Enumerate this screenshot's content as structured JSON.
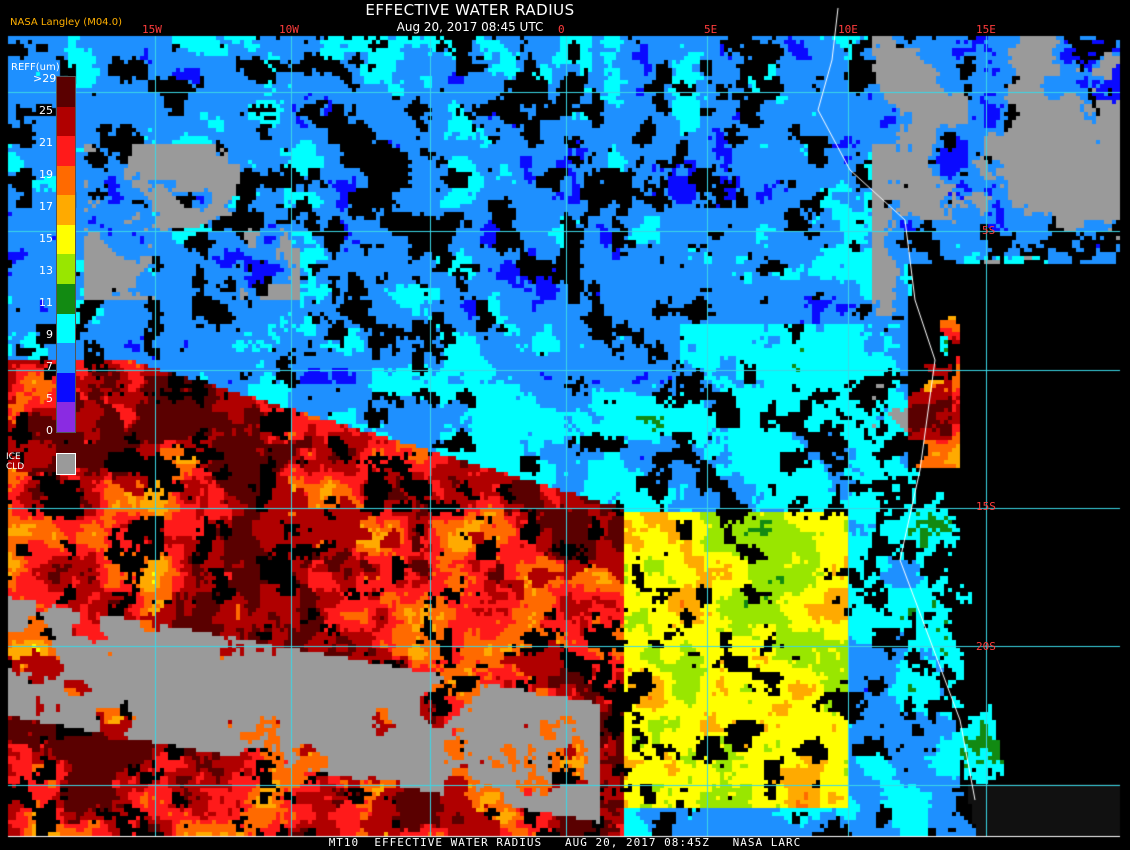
{
  "header": {
    "credit": "NASA Langley (M04.0)",
    "title": "EFFECTIVE WATER RADIUS",
    "subtitle": "Aug 20, 2017 08:45 UTC"
  },
  "legend": {
    "heading": "REFF(um)",
    "ticks": [
      ">29",
      "25",
      "21",
      "19",
      "17",
      "15",
      "13",
      "11",
      "9",
      "7",
      "5",
      "0"
    ],
    "colors": [
      "#5a0000",
      "#b00000",
      "#ff1a1a",
      "#ff6a00",
      "#ffaa00",
      "#ffff00",
      "#99e600",
      "#128a12",
      "#00ffff",
      "#1e90ff",
      "#0a0aff",
      "#8a2be2"
    ],
    "ice_label_1": "ICE",
    "ice_label_2": "CLD",
    "ice_color": "#9a9a9a"
  },
  "graticule": {
    "longitudes": [
      "15W",
      "10W",
      "0",
      "5E",
      "10E",
      "15E"
    ],
    "latitudes": [
      "5S",
      "15S",
      "20S"
    ]
  },
  "footer": {
    "text": "MT10  EFFECTIVE WATER RADIUS   AUG 20, 2017 08:45Z   NASA LARC"
  }
}
